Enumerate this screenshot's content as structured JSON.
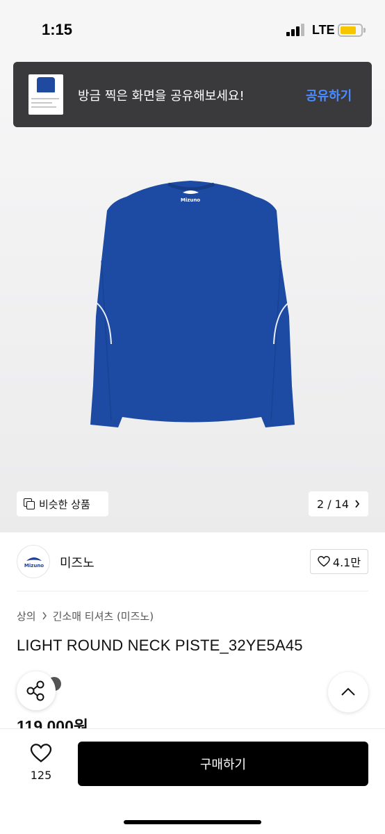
{
  "status": {
    "time": "1:15",
    "network": "LTE"
  },
  "toast": {
    "message": "방금 찍은 화면을 공유해보세요!",
    "action": "공유하기"
  },
  "gallery": {
    "similar_label": "비슷한 상품",
    "page_indicator": "2 / 14",
    "shirt_color": "#1d4aa2",
    "shirt_logo": "Mizuno"
  },
  "brand": {
    "name": "미즈노",
    "logo_text": "Mizuno",
    "likes": "4.1만"
  },
  "breadcrumb": [
    "상의",
    "긴소매 티셔츠 (미즈노)"
  ],
  "product": {
    "title": "LIGHT ROUND NECK PISTE_32YE5A45",
    "price": "119,000원"
  },
  "bottom_bar": {
    "wish_count": "125",
    "buy_label": "구매하기"
  },
  "colors": {
    "accent_blue": "#4a8cff",
    "buy_button": "#000000",
    "toast_bg": "#3a3a3c"
  }
}
